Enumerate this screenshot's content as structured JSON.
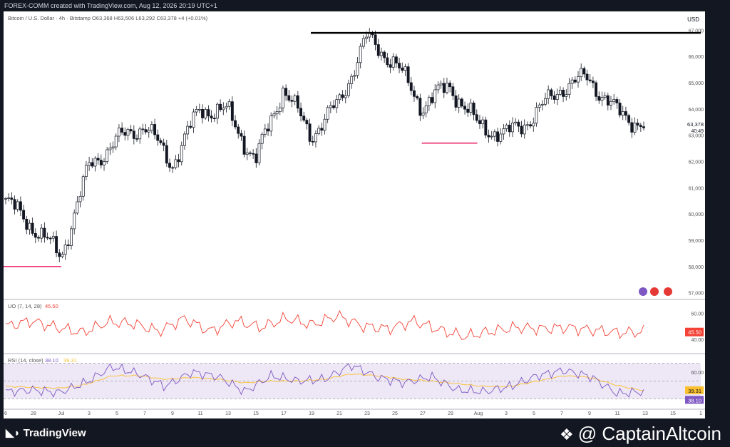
{
  "header": {
    "text": "FOREX-COMM created with TradingView.com, Aug 12, 2026 20:19 UTC+1"
  },
  "legend": {
    "symbol": "Bitcoin / U.S. Dollar · 4h · Bitstamp",
    "open": "O63,368",
    "high": "H63,506",
    "low": "L63,292",
    "close": "C63,378",
    "change": "+4 (+0.01%)"
  },
  "currency": "USD",
  "price_axis": {
    "ticks": [
      "67,000",
      "66,000",
      "65,000",
      "64,000",
      "63,000",
      "62,000",
      "61,000",
      "60,000",
      "59,000",
      "58,000",
      "57,000"
    ]
  },
  "last_price": {
    "value": "63,378",
    "countdown": "40:49"
  },
  "uo_panel": {
    "title": "UO (7, 14, 28)",
    "value": "45.50",
    "ticks": [
      "60.00",
      "40.00"
    ],
    "label": "45.50"
  },
  "rsi_panel": {
    "title": "RSI (14, close)",
    "value": "38.10",
    "ma_value": "39.31",
    "ticks": [
      "60.00"
    ],
    "labels": [
      "39.31",
      "38.10"
    ]
  },
  "time_axis": {
    "ticks": [
      "6",
      "28",
      "Jul",
      "3",
      "5",
      "7",
      "9",
      "11",
      "13",
      "15",
      "17",
      "19",
      "21",
      "23",
      "25",
      "27",
      "29",
      "Aug",
      "3",
      "5",
      "7",
      "9",
      "11",
      "13",
      "15",
      "1"
    ]
  },
  "footer": {
    "left_logo": "TradingView",
    "right_logo": "@ CaptainAltcoin"
  },
  "colors": {
    "up": "#131722",
    "down": "#131722",
    "support_line": "#e91e63",
    "resistance_line": "#000000",
    "uo_line": "#f44336",
    "rsi_line": "#7e57c2",
    "rsi_ma": "#fbc02d",
    "rsi_band": "#ede7f6"
  },
  "chart_data": [
    {
      "type": "line",
      "title": "Bitcoin / U.S. Dollar · 4h · Bitstamp",
      "xlabel": "",
      "ylabel": "USD",
      "ylim": [
        56800,
        67500
      ],
      "x": [
        "Jun 26",
        "Jun 28",
        "Jul 1",
        "Jul 3",
        "Jul 5",
        "Jul 7",
        "Jul 9",
        "Jul 11",
        "Jul 13",
        "Jul 15",
        "Jul 17",
        "Jul 19",
        "Jul 21",
        "Jul 23",
        "Jul 25",
        "Jul 27",
        "Jul 29",
        "Aug 1",
        "Aug 3",
        "Aug 5",
        "Aug 7",
        "Aug 9",
        "Aug 11",
        "Aug 12"
      ],
      "series": [
        {
          "name": "Close",
          "values": [
            60500,
            59500,
            58400,
            61800,
            62800,
            63400,
            61900,
            64000,
            63900,
            62000,
            64800,
            63000,
            64200,
            66700,
            65800,
            64100,
            64900,
            63400,
            63000,
            63700,
            64800,
            65200,
            63900,
            63378
          ]
        }
      ],
      "levels": [
        {
          "price": 66900,
          "color": "#000000",
          "from": "Jul 19",
          "to": "Aug 15"
        },
        {
          "price": 58000,
          "color": "#e91e63",
          "from": "Jun 25",
          "to": "Jul 1"
        },
        {
          "price": 62700,
          "color": "#e91e63",
          "from": "Jul 27",
          "to": "Aug 1"
        }
      ]
    },
    {
      "type": "line",
      "title": "UO (7, 14, 28)",
      "ylim": [
        30,
        70
      ],
      "series": [
        {
          "name": "UO",
          "values": [
            50,
            54,
            49,
            45,
            53,
            52,
            46,
            56,
            46,
            54,
            49,
            56,
            51,
            58,
            50,
            48,
            54,
            47,
            42,
            46,
            49,
            48,
            49,
            47,
            45,
            45.5
          ]
        }
      ]
    },
    {
      "type": "line",
      "title": "RSI (14, close)",
      "ylim": [
        20,
        80
      ],
      "series": [
        {
          "name": "RSI",
          "values": [
            38,
            40,
            37,
            48,
            66,
            58,
            44,
            60,
            55,
            38,
            56,
            50,
            52,
            68,
            54,
            48,
            55,
            40,
            38,
            44,
            56,
            62,
            55,
            36,
            38.1
          ]
        },
        {
          "name": "RSI MA",
          "values": [
            44,
            43,
            42,
            46,
            56,
            56,
            52,
            54,
            52,
            48,
            50,
            50,
            52,
            58,
            56,
            52,
            50,
            47,
            44,
            44,
            50,
            56,
            54,
            45,
            39.31
          ]
        }
      ]
    }
  ]
}
